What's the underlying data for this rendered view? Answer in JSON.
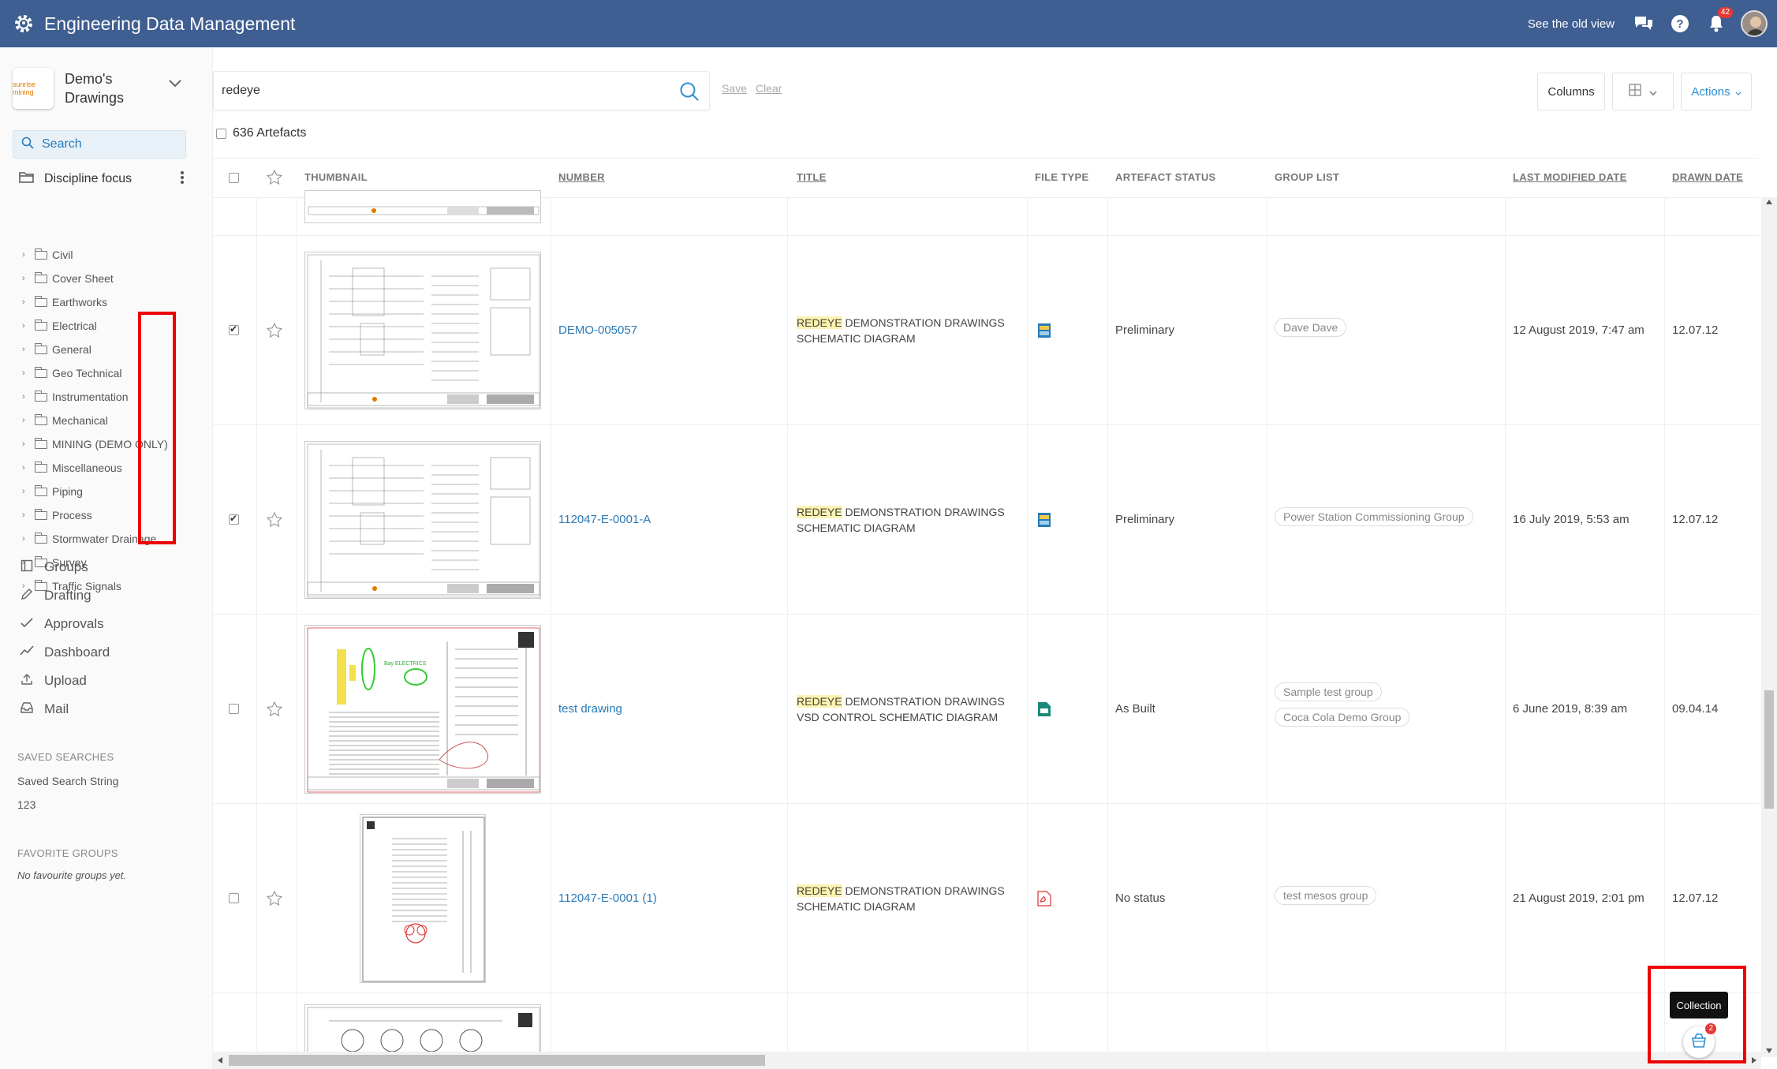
{
  "app": {
    "title": "Engineering Data Management",
    "old_view": "See the old view",
    "notifications_count": "42"
  },
  "sidebar": {
    "project_logo_text": "sunrise mining",
    "project_name": "Demo's Drawings",
    "search_label": "Search",
    "discipline_label": "Discipline focus",
    "tree": [
      "Civil",
      "Cover Sheet",
      "Earthworks",
      "Electrical",
      "General",
      "Geo Technical",
      "Instrumentation",
      "Mechanical",
      "MINING (DEMO ONLY)",
      "Miscellaneous",
      "Piping",
      "Process",
      "Stormwater Drainage",
      "Survey",
      "Traffic Signals"
    ],
    "nav": {
      "groups": "Groups",
      "drafting": "Drafting",
      "approvals": "Approvals",
      "dashboard": "Dashboard",
      "upload": "Upload",
      "mail": "Mail"
    },
    "saved_searches_heading": "SAVED SEARCHES",
    "saved_searches": [
      "Saved Search String",
      "123"
    ],
    "favorite_groups_heading": "FAVORITE GROUPS",
    "favorite_groups_empty": "No favourite groups yet."
  },
  "toolbar": {
    "search_value": "redeye",
    "save_label": "Save",
    "clear_label": "Clear",
    "artefact_count": "636 Artefacts",
    "columns_label": "Columns",
    "actions_label": "Actions"
  },
  "table": {
    "headers": {
      "thumbnail": "THUMBNAIL",
      "number": "NUMBER",
      "title": "TITLE",
      "file_type": "FILE TYPE",
      "status": "ARTEFACT STATUS",
      "group_list": "GROUP LIST",
      "last_modified": "LAST MODIFIED DATE",
      "drawn_date": "DRAWN DATE"
    },
    "rows": [
      {
        "number": "DEMO-005057",
        "title_hl": "REDEYE",
        "title_rest": " DEMONSTRATION DRAWINGS SCHEMATIC DIAGRAM",
        "status": "Preliminary",
        "groups": [
          "Dave Dave"
        ],
        "modified": "12 August 2019, 7:47 am",
        "drawn": "12.07.12",
        "checked": true
      },
      {
        "number": "112047-E-0001-A",
        "title_hl": "REDEYE",
        "title_rest": " DEMONSTRATION DRAWINGS SCHEMATIC DIAGRAM",
        "status": "Preliminary",
        "groups": [
          "Power Station Commissioning Group"
        ],
        "modified": "16 July 2019, 5:53 am",
        "drawn": "12.07.12",
        "checked": true
      },
      {
        "number": "test drawing",
        "title_hl": "REDEYE",
        "title_rest": " DEMONSTRATION DRAWINGS VSD CONTROL SCHEMATIC DIAGRAM",
        "status": "As Built",
        "groups": [
          "Sample test group",
          "Coca Cola Demo Group"
        ],
        "modified": "6 June 2019, 8:39 am",
        "drawn": "09.04.14",
        "checked": false
      },
      {
        "number": "112047-E-0001 (1)",
        "title_hl": "REDEYE",
        "title_rest": " DEMONSTRATION DRAWINGS SCHEMATIC DIAGRAM",
        "status": "No status",
        "groups": [
          "test mesos group"
        ],
        "modified": "21 August 2019, 2:01 pm",
        "drawn": "12.07.12",
        "checked": false
      }
    ]
  },
  "collection": {
    "tooltip": "Collection",
    "count": "2"
  },
  "colors": {
    "topbar": "#3f5e91",
    "link": "#2a7ab8",
    "highlight_box": "#e00000"
  }
}
